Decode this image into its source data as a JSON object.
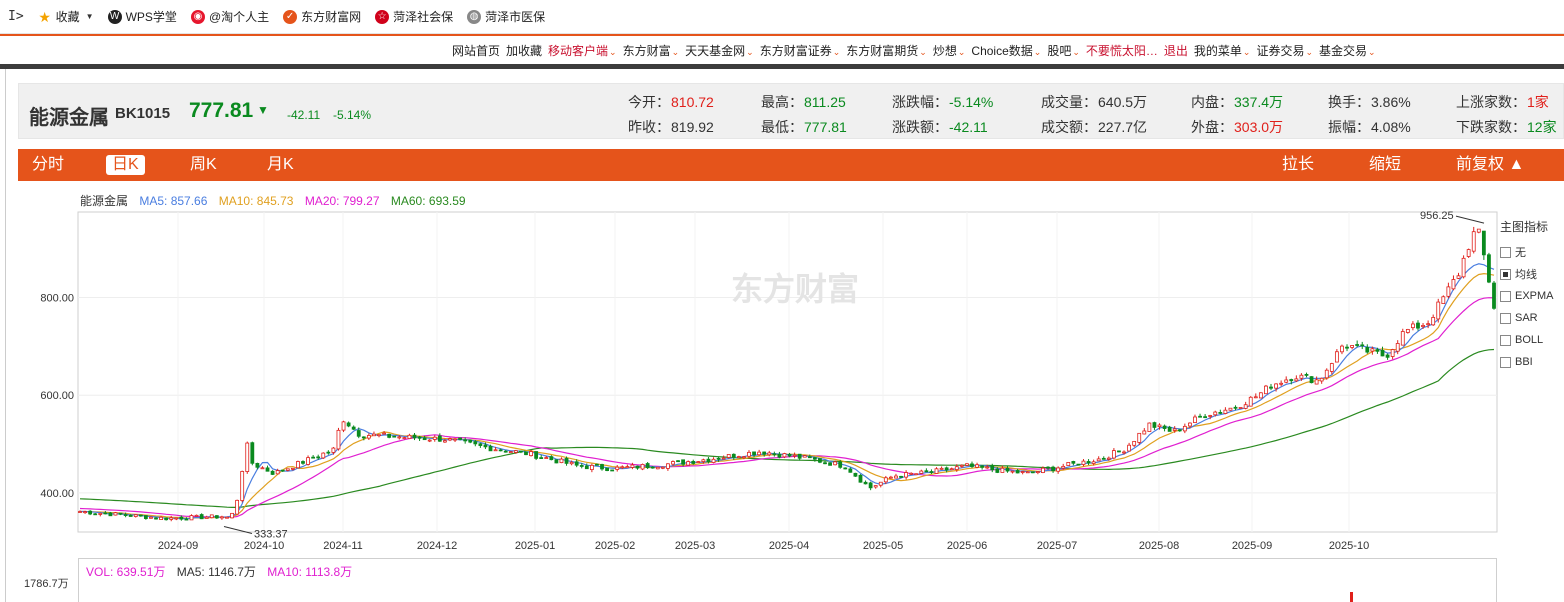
{
  "bookmarks": {
    "toggle": "I>",
    "items": [
      {
        "label": "收藏",
        "icon": "star-icon",
        "color": "#f4a300"
      },
      {
        "label": "WPS学堂",
        "icon": "wps-logo-icon",
        "color": "#222222"
      },
      {
        "label": "@淘个人主",
        "icon": "weibo-icon",
        "color": "#e6162d"
      },
      {
        "label": "东方财富网",
        "icon": "eastmoney-icon",
        "color": "#e5541b"
      },
      {
        "label": "菏泽社会保",
        "icon": "emblem-icon",
        "color": "#d0021b"
      },
      {
        "label": "菏泽市医保",
        "icon": "globe-icon",
        "color": "#888888"
      }
    ]
  },
  "site_nav": {
    "items": [
      {
        "label": "网站首页",
        "dropdown": false,
        "red": false
      },
      {
        "label": "加收藏",
        "dropdown": false,
        "red": false
      },
      {
        "label": "移动客户端",
        "dropdown": true,
        "red": true
      },
      {
        "label": "东方财富",
        "dropdown": true,
        "red": false
      },
      {
        "label": "天天基金网",
        "dropdown": true,
        "red": false
      },
      {
        "label": "东方财富证券",
        "dropdown": true,
        "red": false
      },
      {
        "label": "东方财富期货",
        "dropdown": true,
        "red": false
      },
      {
        "label": "炒想",
        "dropdown": true,
        "red": false
      },
      {
        "label": "Choice数据",
        "dropdown": true,
        "red": false
      },
      {
        "label": "股吧",
        "dropdown": true,
        "red": false
      },
      {
        "label": "不要慌太阳…",
        "dropdown": false,
        "red": true
      },
      {
        "label": "退出",
        "dropdown": false,
        "red": true
      },
      {
        "label": "我的菜单",
        "dropdown": true,
        "red": false
      },
      {
        "label": "证券交易",
        "dropdown": true,
        "red": false
      },
      {
        "label": "基金交易",
        "dropdown": true,
        "red": false
      }
    ]
  },
  "quote": {
    "name": "能源金属",
    "code": "BK1015",
    "price": "777.81",
    "arrow": "▼",
    "change": "-42.11",
    "change_pct": "-5.14%",
    "stats": [
      {
        "label": "今开：",
        "value": "810.72",
        "tone": "red"
      },
      {
        "label": "昨收：",
        "value": "819.92",
        "tone": "plain"
      },
      {
        "label": "最高：",
        "value": "811.25",
        "tone": "green"
      },
      {
        "label": "最低：",
        "value": "777.81",
        "tone": "green"
      },
      {
        "label": "涨跌幅：",
        "value": "-5.14%",
        "tone": "green"
      },
      {
        "label": "涨跌额：",
        "value": "-42.11",
        "tone": "green"
      },
      {
        "label": "成交量：",
        "value": "640.5万",
        "tone": "plain"
      },
      {
        "label": "成交额：",
        "value": "227.7亿",
        "tone": "plain"
      },
      {
        "label": "内盘：",
        "value": "337.4万",
        "tone": "green"
      },
      {
        "label": "外盘：",
        "value": "303.0万",
        "tone": "red"
      },
      {
        "label": "换手：",
        "value": "3.86%",
        "tone": "plain"
      },
      {
        "label": "振幅：",
        "value": "4.08%",
        "tone": "plain"
      },
      {
        "label": "上涨家数：",
        "value": "1家",
        "tone": "red"
      },
      {
        "label": "下跌家数：",
        "value": "12家",
        "tone": "green"
      }
    ]
  },
  "tabs": {
    "left": [
      "分时",
      "日K",
      "周K",
      "月K"
    ],
    "active": "日K",
    "right": [
      "拉长",
      "缩短",
      "前复权 ▲"
    ]
  },
  "ma_legend": {
    "name": "能源金属",
    "ma5": "MA5: 857.66",
    "ma10": "MA10: 845.73",
    "ma20": "MA20: 799.27",
    "ma60": "MA60: 693.59",
    "colors": {
      "ma5": "#4a7ee0",
      "ma10": "#e0a020",
      "ma20": "#e020d0",
      "ma60": "#2a8a20"
    }
  },
  "indicator_panel": {
    "title": "主图指标",
    "items": [
      {
        "label": "无",
        "checked": false
      },
      {
        "label": "均线",
        "checked": true
      },
      {
        "label": "EXPMA",
        "checked": false
      },
      {
        "label": "SAR",
        "checked": false
      },
      {
        "label": "BOLL",
        "checked": false
      },
      {
        "label": "BBI",
        "checked": false
      }
    ]
  },
  "watermark": "东方财富",
  "volume": {
    "vol": "VOL: 639.51万",
    "ma5": "MA5: 1146.7万",
    "ma10": "MA10: 1113.8万",
    "max_label": "1786.7万"
  },
  "chart_data": {
    "type": "candlestick",
    "title": "能源金属",
    "y_ticks": [
      400,
      600,
      800
    ],
    "y_tick_labels": [
      "400.00",
      "600.00",
      "800.00"
    ],
    "ylim": [
      320,
      975
    ],
    "x_tick_labels": [
      "2024-09",
      "2024-10",
      "2024-11",
      "2024-12",
      "2025-01",
      "2025-02",
      "2025-03",
      "2025-04",
      "2025-05",
      "2025-06",
      "2025-07",
      "2025-08",
      "2025-09",
      "2025-10"
    ],
    "annotations": [
      {
        "text": "956.25",
        "value": 956.25,
        "kind": "high"
      },
      {
        "text": "333.37",
        "value": 333.37,
        "kind": "low"
      }
    ],
    "close_path": [
      {
        "x": 0,
        "y": 362
      },
      {
        "x": 0.07,
        "y": 348
      },
      {
        "x": 0.12,
        "y": 352
      },
      {
        "x": 0.1,
        "y": 348
      },
      {
        "x": 0.115,
        "y": 340
      },
      {
        "x": 0.126,
        "y": 358
      },
      {
        "x": 0.132,
        "y": 410
      },
      {
        "x": 0.136,
        "y": 510
      },
      {
        "x": 0.142,
        "y": 460
      },
      {
        "x": 0.16,
        "y": 440
      },
      {
        "x": 0.19,
        "y": 470
      },
      {
        "x": 0.21,
        "y": 490
      },
      {
        "x": 0.215,
        "y": 555
      },
      {
        "x": 0.23,
        "y": 520
      },
      {
        "x": 0.26,
        "y": 515
      },
      {
        "x": 0.3,
        "y": 510
      },
      {
        "x": 0.33,
        "y": 495
      },
      {
        "x": 0.37,
        "y": 480
      },
      {
        "x": 0.41,
        "y": 455
      },
      {
        "x": 0.44,
        "y": 450
      },
      {
        "x": 0.48,
        "y": 458
      },
      {
        "x": 0.52,
        "y": 470
      },
      {
        "x": 0.56,
        "y": 485
      },
      {
        "x": 0.6,
        "y": 470
      },
      {
        "x": 0.63,
        "y": 455
      },
      {
        "x": 0.65,
        "y": 410
      },
      {
        "x": 0.67,
        "y": 435
      },
      {
        "x": 0.7,
        "y": 442
      },
      {
        "x": 0.73,
        "y": 455
      },
      {
        "x": 0.76,
        "y": 445
      },
      {
        "x": 0.78,
        "y": 440
      },
      {
        "x": 0.81,
        "y": 455
      },
      {
        "x": 0.84,
        "y": 470
      },
      {
        "x": 0.86,
        "y": 490
      },
      {
        "x": 0.88,
        "y": 540
      },
      {
        "x": 0.9,
        "y": 525
      },
      {
        "x": 0.925,
        "y": 560
      },
      {
        "x": 0.95,
        "y": 575
      },
      {
        "x": 0.97,
        "y": 600
      },
      {
        "x": 0.98,
        "y": 620
      },
      {
        "x": 1.0,
        "y": 640
      },
      {
        "x": 1.02,
        "y": 630
      },
      {
        "x": 1.04,
        "y": 705
      },
      {
        "x": 1.06,
        "y": 690
      },
      {
        "x": 1.075,
        "y": 680
      },
      {
        "x": 1.09,
        "y": 730
      },
      {
        "x": 1.11,
        "y": 750
      },
      {
        "x": 1.12,
        "y": 790
      },
      {
        "x": 1.135,
        "y": 850
      },
      {
        "x": 1.142,
        "y": 900
      },
      {
        "x": 1.15,
        "y": 945
      },
      {
        "x": 1.158,
        "y": 860
      },
      {
        "x": 1.164,
        "y": 778
      }
    ],
    "ma_start": {
      "ma5": 362,
      "ma10": 362,
      "ma20": 368,
      "ma60": 388
    },
    "ma_end": {
      "ma5": 857.66,
      "ma10": 845.73,
      "ma20": 799.27,
      "ma60": 693.59
    }
  }
}
